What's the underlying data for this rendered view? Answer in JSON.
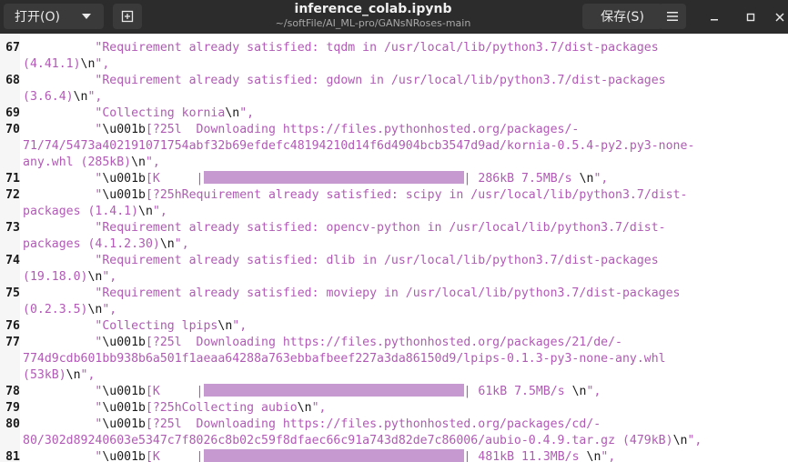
{
  "header": {
    "open_label": "打开(O)",
    "title": "inference_colab.ipynb",
    "path": "~/softFile/AI_ML-pro/GANsNRoses-main",
    "save_label": "保存(S)"
  },
  "icons": {
    "open_caret": "chevron-down-icon",
    "new_document": "new-document-icon",
    "menu": "hamburger-menu-icon",
    "minimize": "minimize-icon",
    "maximize": "maximize-icon",
    "close": "close-icon"
  },
  "colors": {
    "string": "#b15ab5",
    "escape": "#1a1a1a",
    "progress_bar": "#c69ad0",
    "titlebar": "#2c2c2c"
  },
  "lines": [
    {
      "num": "67",
      "segs": [
        {
          "t": "          \"Requirement already satisfied: tqdm in /usr/local/lib/python3.7/dist-packages",
          "k": "str"
        }
      ]
    },
    {
      "num": "",
      "segs": [
        {
          "t": "(4.41.1)",
          "k": "str"
        },
        {
          "t": "\\n",
          "k": "esc"
        },
        {
          "t": "\",",
          "k": "str"
        }
      ]
    },
    {
      "num": "68",
      "segs": [
        {
          "t": "          \"Requirement already satisfied: gdown in /usr/local/lib/python3.7/dist-packages",
          "k": "str"
        }
      ]
    },
    {
      "num": "",
      "segs": [
        {
          "t": "(3.6.4)",
          "k": "str"
        },
        {
          "t": "\\n",
          "k": "esc"
        },
        {
          "t": "\",",
          "k": "str"
        }
      ]
    },
    {
      "num": "69",
      "segs": [
        {
          "t": "          \"Collecting kornia",
          "k": "str"
        },
        {
          "t": "\\n",
          "k": "esc"
        },
        {
          "t": "\",",
          "k": "str"
        }
      ]
    },
    {
      "num": "70",
      "segs": [
        {
          "t": "          \"",
          "k": "str"
        },
        {
          "t": "\\u001b",
          "k": "esc"
        },
        {
          "t": "[?25l  Downloading https://files.pythonhosted.org/packages/-",
          "k": "str"
        }
      ]
    },
    {
      "num": "",
      "segs": [
        {
          "t": "71/74/5473a402191071754abf32b69efdefc48194210d14f6d4904bcb3547d9ad/kornia-0.5.4-py2.py3-none-",
          "k": "str"
        }
      ]
    },
    {
      "num": "",
      "segs": [
        {
          "t": "any.whl (285kB)",
          "k": "str"
        },
        {
          "t": "\\n",
          "k": "esc"
        },
        {
          "t": "\",",
          "k": "str"
        }
      ]
    },
    {
      "num": "71",
      "segs": [
        {
          "t": "          \"",
          "k": "str"
        },
        {
          "t": "\\u001b",
          "k": "esc"
        },
        {
          "t": "[K     |",
          "k": "str"
        },
        {
          "t": "",
          "k": "bar"
        },
        {
          "t": "| 286kB 7.5MB/s ",
          "k": "str"
        },
        {
          "t": "\\n",
          "k": "esc"
        },
        {
          "t": "\",",
          "k": "str"
        }
      ]
    },
    {
      "num": "72",
      "segs": [
        {
          "t": "          \"",
          "k": "str"
        },
        {
          "t": "\\u001b",
          "k": "esc"
        },
        {
          "t": "[?25hRequirement already satisfied: scipy in /usr/local/lib/python3.7/dist-",
          "k": "str"
        }
      ]
    },
    {
      "num": "",
      "segs": [
        {
          "t": "packages (1.4.1)",
          "k": "str"
        },
        {
          "t": "\\n",
          "k": "esc"
        },
        {
          "t": "\",",
          "k": "str"
        }
      ]
    },
    {
      "num": "73",
      "segs": [
        {
          "t": "          \"Requirement already satisfied: opencv-python in /usr/local/lib/python3.7/dist-",
          "k": "str"
        }
      ]
    },
    {
      "num": "",
      "segs": [
        {
          "t": "packages (4.1.2.30)",
          "k": "str"
        },
        {
          "t": "\\n",
          "k": "esc"
        },
        {
          "t": "\",",
          "k": "str"
        }
      ]
    },
    {
      "num": "74",
      "segs": [
        {
          "t": "          \"Requirement already satisfied: dlib in /usr/local/lib/python3.7/dist-packages",
          "k": "str"
        }
      ]
    },
    {
      "num": "",
      "segs": [
        {
          "t": "(19.18.0)",
          "k": "str"
        },
        {
          "t": "\\n",
          "k": "esc"
        },
        {
          "t": "\",",
          "k": "str"
        }
      ]
    },
    {
      "num": "75",
      "segs": [
        {
          "t": "          \"Requirement already satisfied: moviepy in /usr/local/lib/python3.7/dist-packages",
          "k": "str"
        }
      ]
    },
    {
      "num": "",
      "segs": [
        {
          "t": "(0.2.3.5)",
          "k": "str"
        },
        {
          "t": "\\n",
          "k": "esc"
        },
        {
          "t": "\",",
          "k": "str"
        }
      ]
    },
    {
      "num": "76",
      "segs": [
        {
          "t": "          \"Collecting lpips",
          "k": "str"
        },
        {
          "t": "\\n",
          "k": "esc"
        },
        {
          "t": "\",",
          "k": "str"
        }
      ]
    },
    {
      "num": "77",
      "segs": [
        {
          "t": "          \"",
          "k": "str"
        },
        {
          "t": "\\u001b",
          "k": "esc"
        },
        {
          "t": "[?25l  Downloading https://files.pythonhosted.org/packages/21/de/-",
          "k": "str"
        }
      ]
    },
    {
      "num": "",
      "segs": [
        {
          "t": "774d9cdb601bb938b6a501f1aeaa64288a763ebbafbeef227a3da86150d9/lpips-0.1.3-py3-none-any.whl",
          "k": "str"
        }
      ]
    },
    {
      "num": "",
      "segs": [
        {
          "t": "(53kB)",
          "k": "str"
        },
        {
          "t": "\\n",
          "k": "esc"
        },
        {
          "t": "\",",
          "k": "str"
        }
      ]
    },
    {
      "num": "78",
      "segs": [
        {
          "t": "          \"",
          "k": "str"
        },
        {
          "t": "\\u001b",
          "k": "esc"
        },
        {
          "t": "[K     |",
          "k": "str"
        },
        {
          "t": "",
          "k": "bar"
        },
        {
          "t": "| 61kB 7.5MB/s ",
          "k": "str"
        },
        {
          "t": "\\n",
          "k": "esc"
        },
        {
          "t": "\",",
          "k": "str"
        }
      ]
    },
    {
      "num": "79",
      "segs": [
        {
          "t": "          \"",
          "k": "str"
        },
        {
          "t": "\\u001b",
          "k": "esc"
        },
        {
          "t": "[?25hCollecting aubio",
          "k": "str"
        },
        {
          "t": "\\n",
          "k": "esc"
        },
        {
          "t": "\",",
          "k": "str"
        }
      ]
    },
    {
      "num": "80",
      "segs": [
        {
          "t": "          \"",
          "k": "str"
        },
        {
          "t": "\\u001b",
          "k": "esc"
        },
        {
          "t": "[?25l  Downloading https://files.pythonhosted.org/packages/cd/-",
          "k": "str"
        }
      ]
    },
    {
      "num": "",
      "segs": [
        {
          "t": "80/302d89240603e5347c7f8026c8b02c59f8dfaec66c91a743d82de7c86006/aubio-0.4.9.tar.gz (479kB)",
          "k": "str"
        },
        {
          "t": "\\n",
          "k": "esc"
        },
        {
          "t": "\",",
          "k": "str"
        }
      ]
    },
    {
      "num": "81",
      "segs": [
        {
          "t": "          \"",
          "k": "str"
        },
        {
          "t": "\\u001b",
          "k": "esc"
        },
        {
          "t": "[K     |",
          "k": "str"
        },
        {
          "t": "",
          "k": "bar"
        },
        {
          "t": "| 481kB 11.3MB/s ",
          "k": "str"
        },
        {
          "t": "\\n",
          "k": "esc"
        },
        {
          "t": "\",",
          "k": "str"
        }
      ]
    }
  ]
}
